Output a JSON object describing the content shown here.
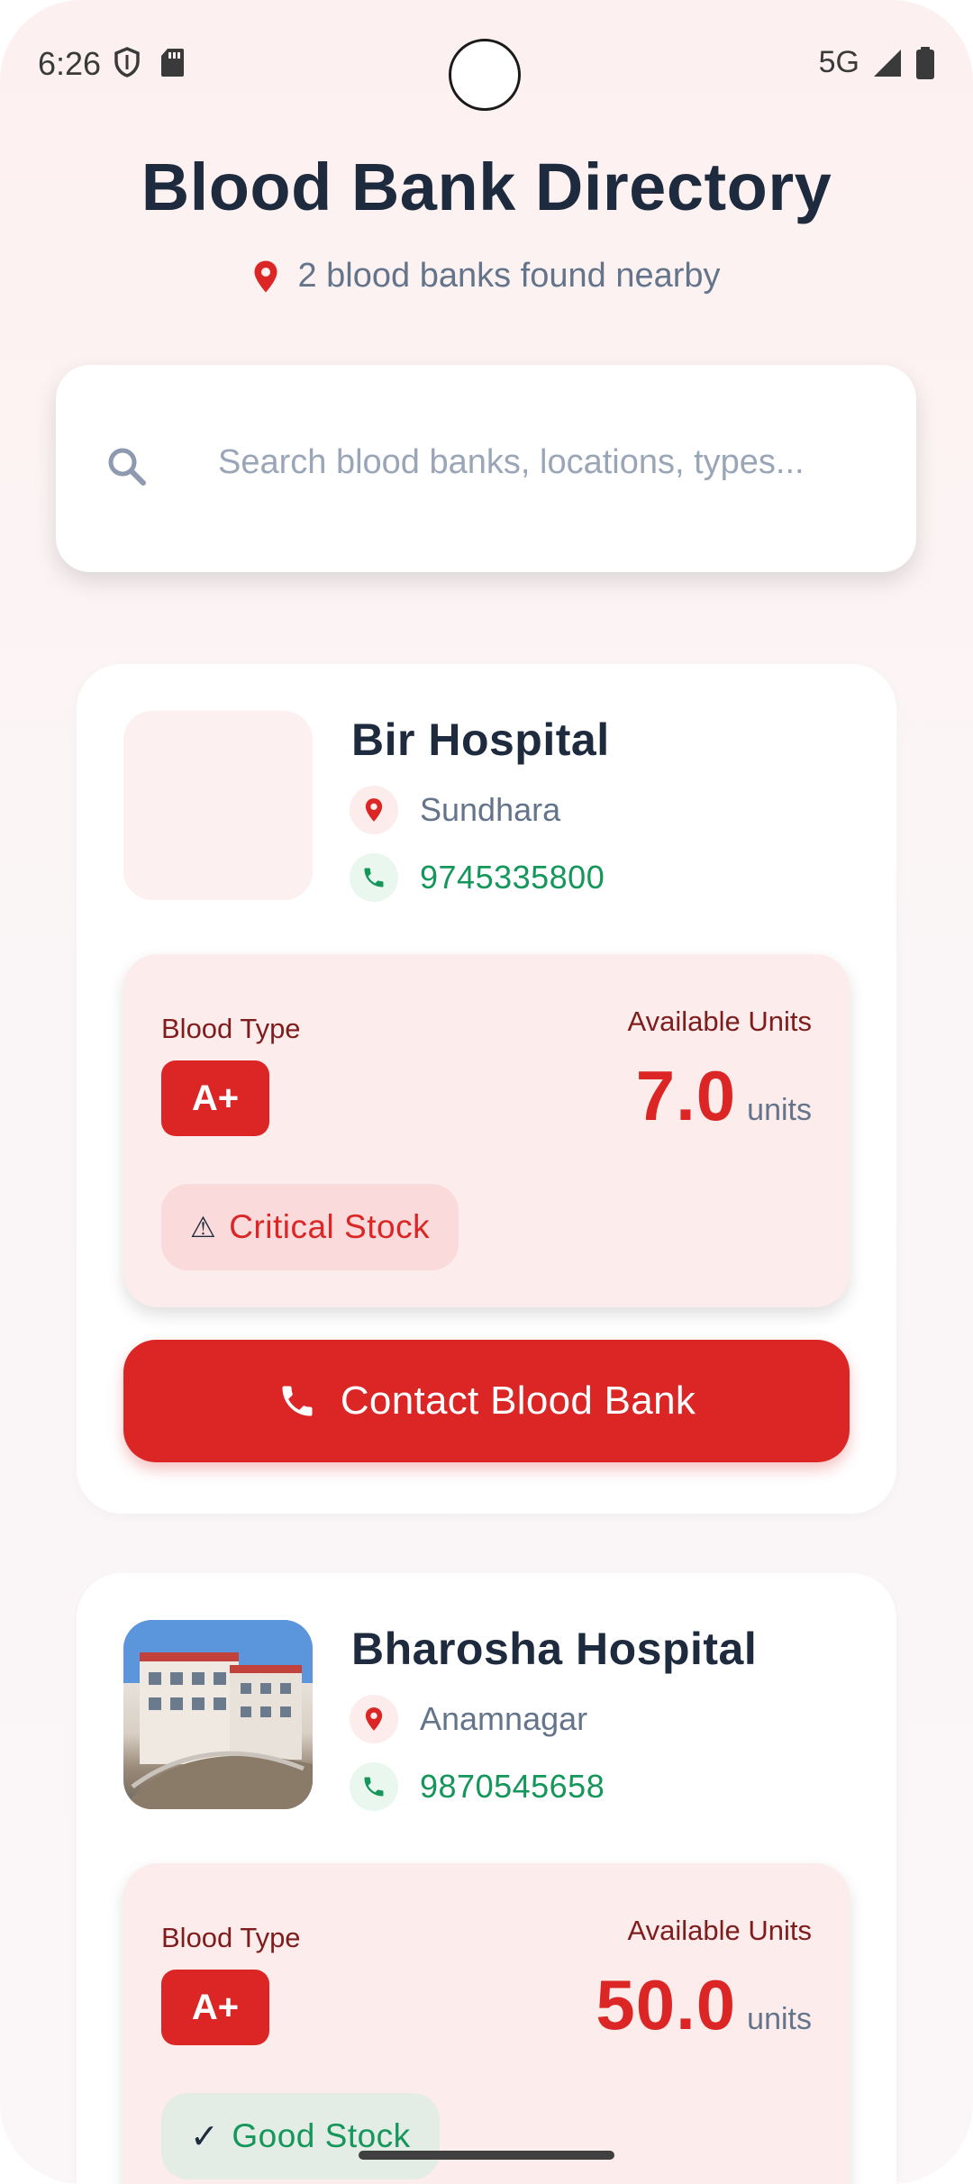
{
  "status_bar": {
    "time": "6:26",
    "network": "5G"
  },
  "header": {
    "title": "Blood Bank Directory",
    "subtitle": "2 blood banks found nearby"
  },
  "search": {
    "placeholder": "Search blood banks, locations, types..."
  },
  "labels": {
    "blood_type": "Blood Type",
    "available_units": "Available Units",
    "units": "units",
    "contact_button": "Contact Blood Bank"
  },
  "banks": [
    {
      "name": "Bir Hospital",
      "location": "Sundhara",
      "phone": "9745335800",
      "blood_type": "A+",
      "units": "7.0",
      "stock_icon": "⚠",
      "stock_status": "Critical Stock"
    },
    {
      "name": "Bharosha Hospital",
      "location": "Anamnagar",
      "phone": "9870545658",
      "blood_type": "A+",
      "units": "50.0",
      "stock_icon": "✓",
      "stock_status": "Good Stock"
    }
  ],
  "colors": {
    "accent": "#dc2626",
    "title": "#1e2a3d",
    "phone_green": "#15965a",
    "background": "#fdf0f0"
  }
}
